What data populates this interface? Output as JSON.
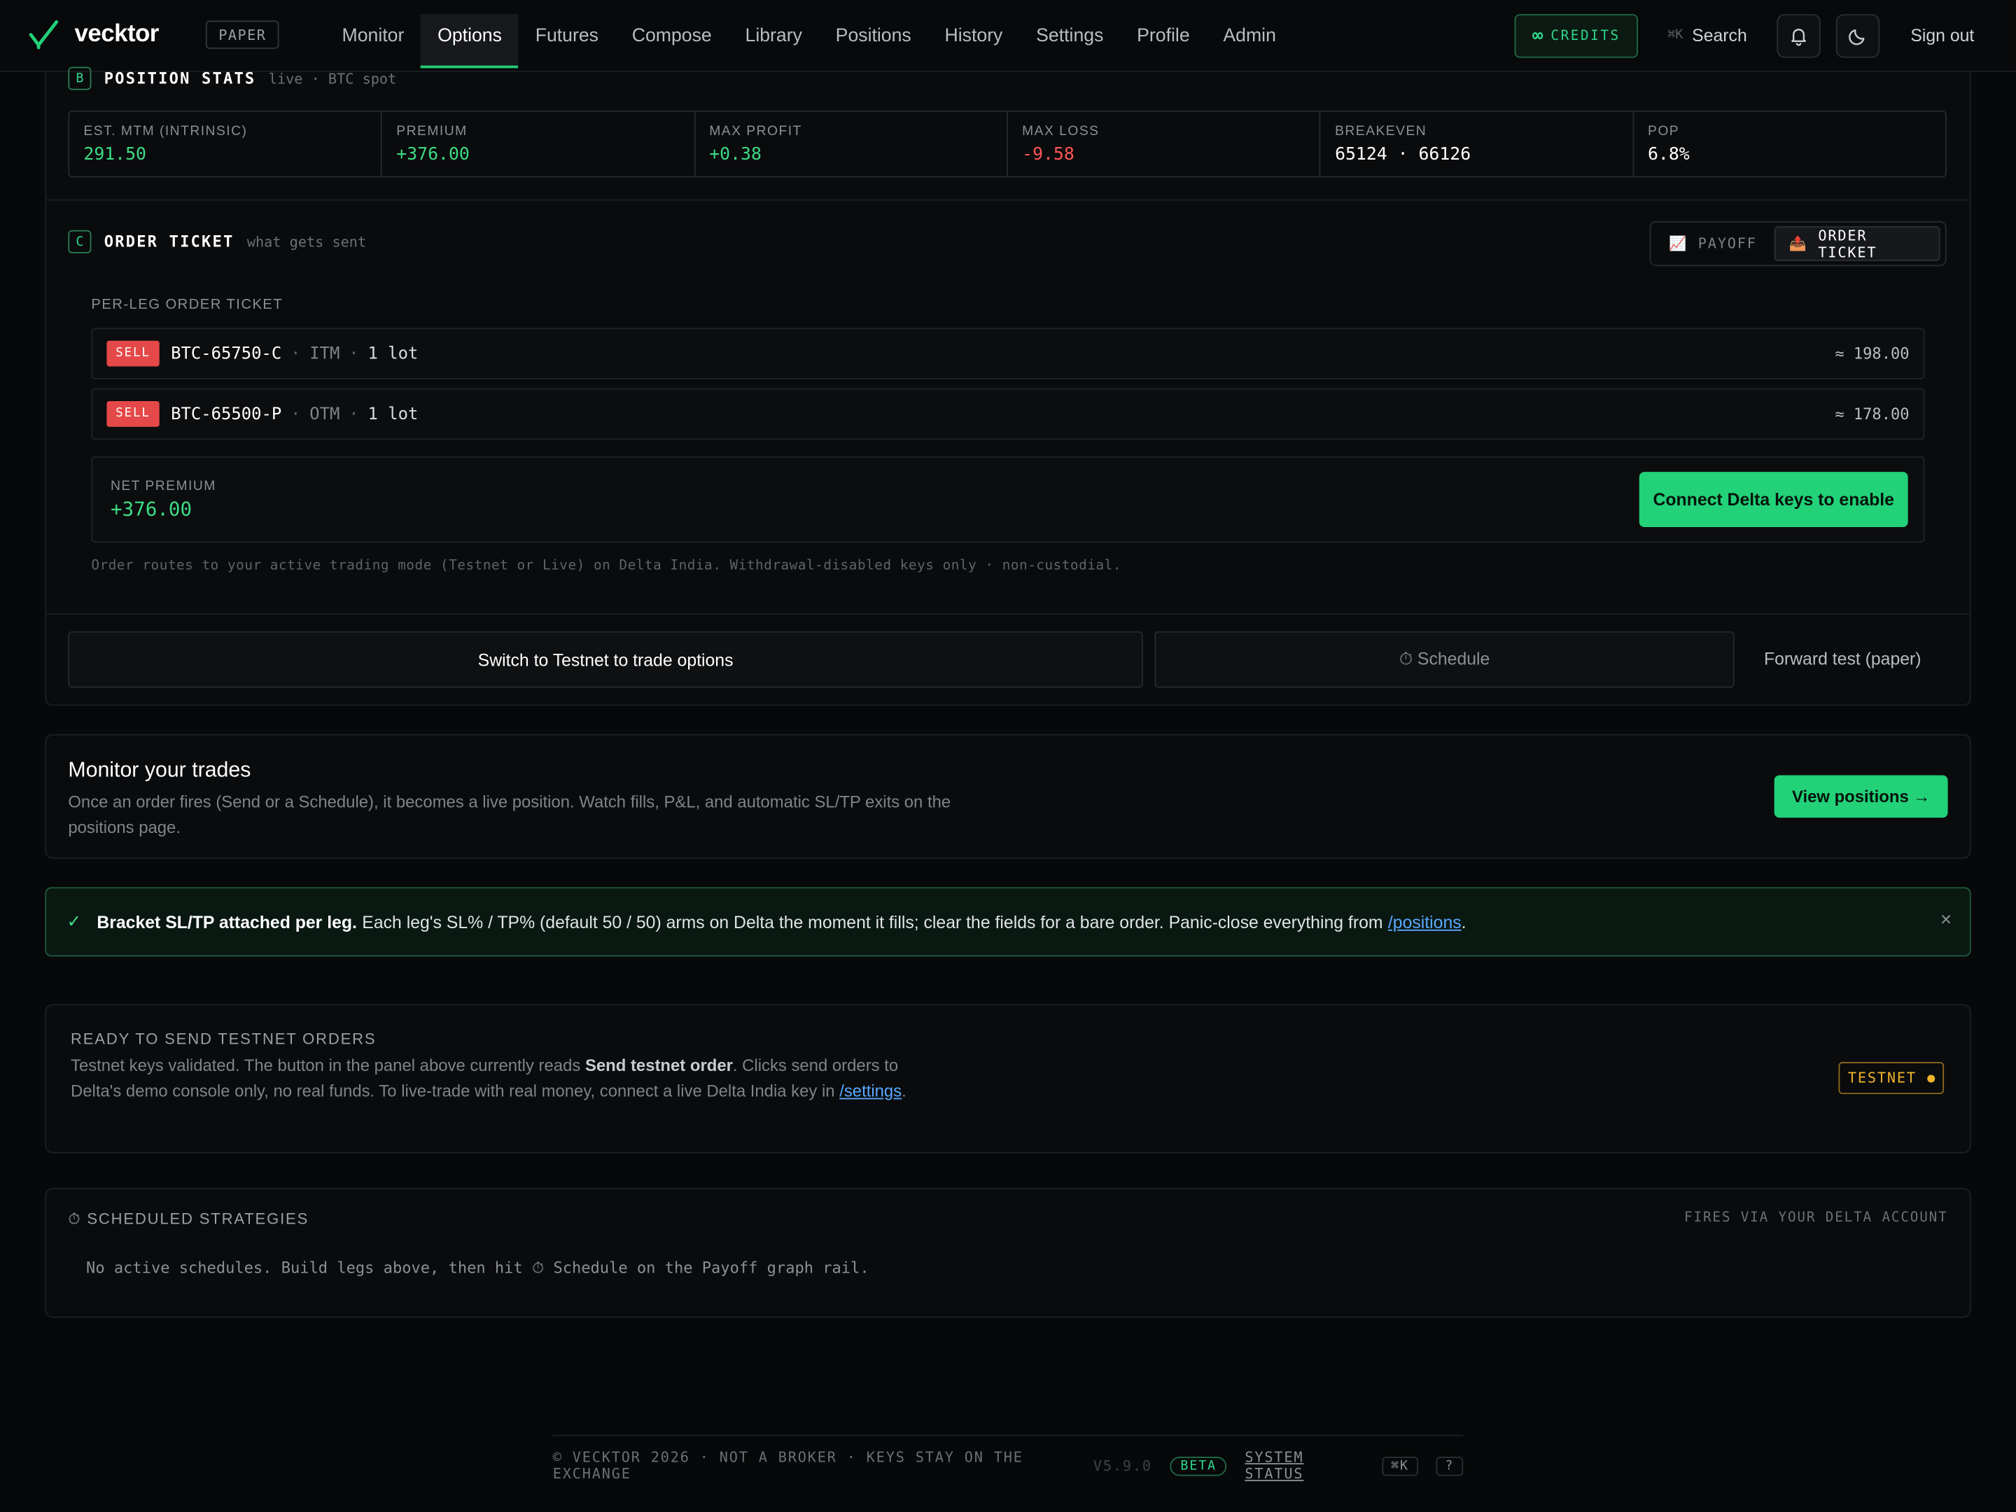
{
  "brand": {
    "name": "vecktor",
    "mode_badge": "PAPER"
  },
  "nav": [
    "Monitor",
    "Options",
    "Futures",
    "Compose",
    "Library",
    "Positions",
    "History",
    "Settings",
    "Profile",
    "Admin"
  ],
  "nav_active": "Options",
  "header": {
    "credits_label": "CREDITS",
    "credits_symbol": "∞",
    "search_label": "Search",
    "search_shortcut": "⌘K",
    "signout_label": "Sign out"
  },
  "position_stats": {
    "tag": "B",
    "title": "POSITION STATS",
    "subtitle": "live · BTC spot",
    "items": [
      {
        "label": "EST. MTM (INTRINSIC)",
        "value": "291.50",
        "color": "#3ddc84"
      },
      {
        "label": "PREMIUM",
        "value": "+376.00",
        "color": "#3ddc84"
      },
      {
        "label": "MAX PROFIT",
        "value": "+0.38",
        "color": "#3ddc84"
      },
      {
        "label": "MAX LOSS",
        "value": "-9.58",
        "color": "#ff5757"
      },
      {
        "label": "BREAKEVEN",
        "value": "65124 · 66126",
        "color": "#ffffff"
      },
      {
        "label": "POP",
        "value": "6.8%",
        "color": "#ffffff"
      }
    ]
  },
  "order_ticket": {
    "tag": "C",
    "title": "ORDER TICKET",
    "subtitle": "what gets sent",
    "toggle": {
      "payoff": "PAYOFF",
      "order_ticket": "ORDER TICKET",
      "active": "order_ticket"
    },
    "per_leg_label": "PER-LEG ORDER TICKET",
    "legs": [
      {
        "side": "SELL",
        "symbol": "BTC-65750-C",
        "moneyness": "ITM",
        "lots": "1 lot",
        "amount": "≈ 198.00"
      },
      {
        "side": "SELL",
        "symbol": "BTC-65500-P",
        "moneyness": "OTM",
        "lots": "1 lot",
        "amount": "≈ 178.00"
      }
    ],
    "net_premium_label": "NET PREMIUM",
    "net_premium_value": "+376.00",
    "connect_button": "Connect Delta keys to enable",
    "note": "Order routes to your active trading mode (Testnet or Live) on Delta India. Withdrawal-disabled keys only · non-custodial."
  },
  "actions": {
    "switch_testnet": "Switch to Testnet to trade options",
    "schedule": "⏱ Schedule",
    "forward_test": "Forward test (paper)"
  },
  "monitor": {
    "title": "Monitor your trades",
    "body": "Once an order fires (Send or a Schedule), it becomes a live position. Watch fills, P&L, and automatic SL/TP exits on the positions page.",
    "button": "View positions →"
  },
  "bracket_banner": {
    "bold": "Bracket SL/TP attached per leg.",
    "text": "Each leg's SL% / TP% (default 50 / 50) arms on Delta the moment it fills; clear the fields for a bare order. Panic-close everything from",
    "link": "/positions",
    "close": "×"
  },
  "testnet_panel": {
    "title": "READY TO SEND TESTNET ORDERS",
    "text_1": "Testnet keys validated. The button in the panel above currently reads",
    "bold": "Send testnet order",
    "text_2": ". Clicks send orders to Delta's demo console only, no real funds. To live-trade with real money, connect a live Delta India key in",
    "link": "/settings",
    "badge": "TESTNET"
  },
  "scheduled": {
    "title": "⏱ SCHEDULED STRATEGIES",
    "right_label": "FIRES VIA YOUR DELTA ACCOUNT",
    "empty": "No active schedules. Build legs above, then hit ⏱ Schedule on the Payoff graph rail."
  },
  "footer": {
    "text": "© VECKTOR 2026 · NOT A BROKER · KEYS STAY ON THE EXCHANGE",
    "version": "V5.9.0",
    "beta": "BETA",
    "status_link": "SYSTEM STATUS",
    "shortcut": "⌘K",
    "help": "?"
  }
}
